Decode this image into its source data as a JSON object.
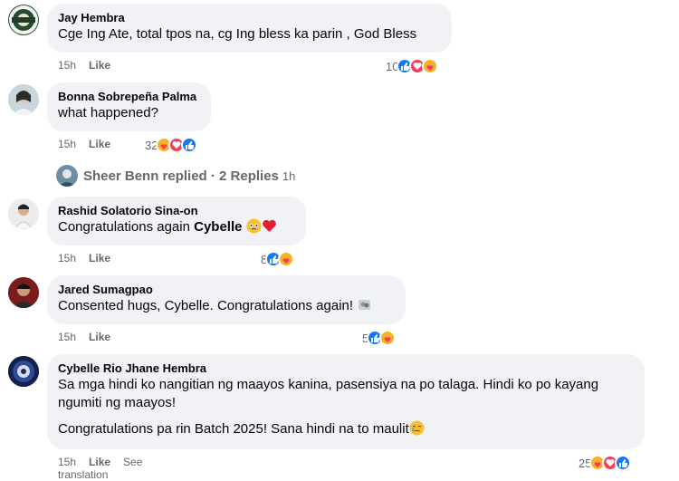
{
  "comments": [
    {
      "author": "Jay Hembra",
      "text": "Cge Ing Ate, total tpos na, cg Ing bless ka parin , God Bless",
      "time": "15h",
      "like_label": "Like",
      "reaction_count": "10"
    },
    {
      "author": "Bonna Sobrepeña Palma",
      "text": "what happened?",
      "time": "15h",
      "like_label": "Like",
      "reaction_count": "32"
    },
    {
      "author": "Rashid Solatorio Sina-on",
      "text_pre": "Congratulations again ",
      "text_bold": "Cybelle",
      "time": "15h",
      "like_label": "Like",
      "reaction_count": "8"
    },
    {
      "author": "Jared Sumagpao",
      "text": "Consented hugs, Cybelle. Congratulations again!",
      "time": "15h",
      "like_label": "Like",
      "reaction_count": "5"
    },
    {
      "author": "Cybelle Rio Jhane Hembra",
      "text_line1": "Sa mga hindi ko nangitian ng maayos kanina, pasensiya na po talaga. Hindi ko po kayang ngumiti ng maayos!",
      "text_line2": "Congratulations pa rin Batch 2025! Sana hindi na to maulit",
      "time": "15h",
      "like_label": "Like",
      "translate_label": "See translation",
      "reaction_count": "25"
    }
  ],
  "replies": {
    "text": "Sheer Benn replied · 2 Replies",
    "time": "1h"
  },
  "colors": {
    "like": "#1877f2",
    "love": "#f33e58",
    "care": "#f7b125",
    "bubble": "#f0f2f5",
    "meta": "#65676b"
  }
}
